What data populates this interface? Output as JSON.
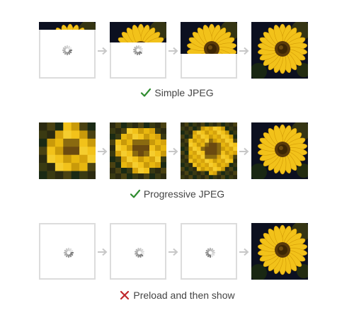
{
  "rows": [
    {
      "caption": "Simple JPEG",
      "status": "success",
      "status_color": "#2e8b2e"
    },
    {
      "caption": "Progressive JPEG",
      "status": "success",
      "status_color": "#2e8b2e"
    },
    {
      "caption": "Preload and then show",
      "status": "failure",
      "status_color": "#c0282d"
    }
  ],
  "simple_reveal_fractions": [
    0.14,
    0.36,
    0.56,
    1.0
  ],
  "progressive_block_counts": [
    7,
    10,
    14,
    80
  ],
  "icons": {
    "check": "check-icon",
    "cross": "cross-icon",
    "arrow": "arrow-right-icon",
    "spinner": "loading-spinner-icon"
  },
  "colors": {
    "frame_border": "#dcdcdc",
    "arrow": "#c8c8c8",
    "petal": "#f2c21a",
    "center": "#5a3a0a",
    "background": "#0c1020"
  }
}
